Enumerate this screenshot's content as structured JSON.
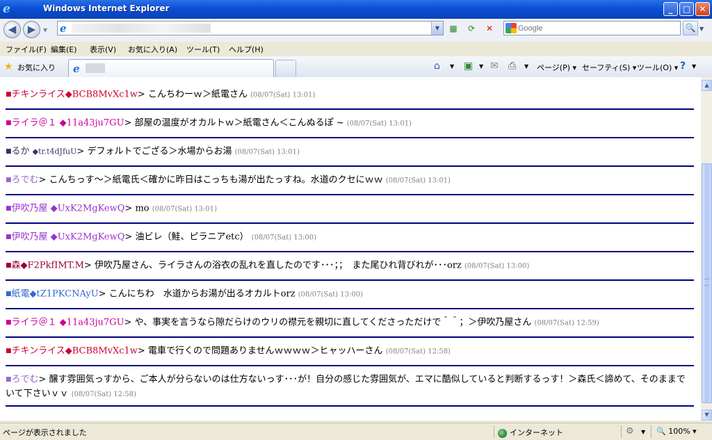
{
  "window": {
    "title": "Windows Internet Explorer",
    "minimize": "_",
    "maximize": "□",
    "close": "✕"
  },
  "address_bar": {
    "url": "",
    "back": "◀",
    "forward": "▶"
  },
  "search": {
    "placeholder": "Google",
    "go": "🔍"
  },
  "menu": [
    "ファイル(F)",
    "編集(E)",
    "表示(V)",
    "お気に入り(A)",
    "ツール(T)",
    "ヘルプ(H)"
  ],
  "favorites_bar": {
    "label": "お気に入り"
  },
  "command_bar": {
    "page": "ページ(P)",
    "safety": "セーフティ(S)",
    "tools": "ツール(O)"
  },
  "posts": [
    {
      "name": "チキンライス",
      "trip": "◆BCB8MvXc1w",
      "message": "こんちわーｗ＞紙電さん",
      "date": "(08/07(Sat) 13:01)",
      "color": "#cc0033"
    },
    {
      "name": "ライラ＠１",
      "trip": "◆11a43ju7GU",
      "message": "部屋の温度がオカルトｗ＞紙電さん＜こんぬるぽ ~",
      "date": "(08/07(Sat) 13:01)",
      "color": "#cc0099"
    },
    {
      "name": "るか",
      "trip": "◆tr.t4dJfuU",
      "message": "デフォルトでござる＞水場からお湯",
      "date": "(08/07(Sat) 13:01)",
      "color": "#333366"
    },
    {
      "name": "ろでむ",
      "trip": "",
      "message": "こんちっす～＞紙電氏＜確かに昨日はこっちも湯が出たっすね。水道のクセにｗｗ",
      "date": "(08/07(Sat) 13:01)",
      "color": "#9966cc"
    },
    {
      "name": "伊吹乃屋",
      "trip": "◆UxK2MgKewQ",
      "message": "mo",
      "date": "(08/07(Sat) 13:01)",
      "color": "#9933cc"
    },
    {
      "name": "伊吹乃屋",
      "trip": "◆UxK2MgKewQ",
      "message": "油ビレ（鮭、ピラニアetc）",
      "date": "(08/07(Sat) 13:00)",
      "color": "#9933cc"
    },
    {
      "name": "森",
      "trip": "◆F2PkfIMT.M",
      "message": "伊吹乃屋さん、ライラさんの浴衣の乱れを直したのです･･･；；　また尾ひれ背びれが･･･orz",
      "date": "(08/07(Sat) 13:00)",
      "color": "#990033"
    },
    {
      "name": "紙電",
      "trip": "◆tZ1PKCNAyU",
      "message": "こんにちわ　水道からお湯が出るオカルトorz",
      "date": "(08/07(Sat) 13:00)",
      "color": "#3366cc"
    },
    {
      "name": "ライラ＠１",
      "trip": "◆11a43ju7GU",
      "message": "や、事実を言うなら隙だらけのウリの襟元を親切に直してくださっただけで＾＾；＞伊吹乃屋さん",
      "date": "(08/07(Sat) 12:59)",
      "color": "#cc0099"
    },
    {
      "name": "チキンライス",
      "trip": "◆BCB8MvXc1w",
      "message": "電車で行くので問題ありませんｗｗｗｗ＞ヒャッハーさん",
      "date": "(08/07(Sat) 12:58)",
      "color": "#cc0033"
    },
    {
      "name": "ろでむ",
      "trip": "",
      "message": "醸す雰囲気っすから、ご本人が分らないのは仕方ないっす･･･が！自分の感じた雰囲気が、エマに酷似していると判断するっす！＞森氏＜諦めて、そのままでいて下さいｖｖ",
      "date": "(08/07(Sat) 12:58)",
      "color": "#9966cc"
    }
  ],
  "status": {
    "text": "ページが表示されました",
    "zone": "インターネット",
    "zoom": "100%"
  }
}
